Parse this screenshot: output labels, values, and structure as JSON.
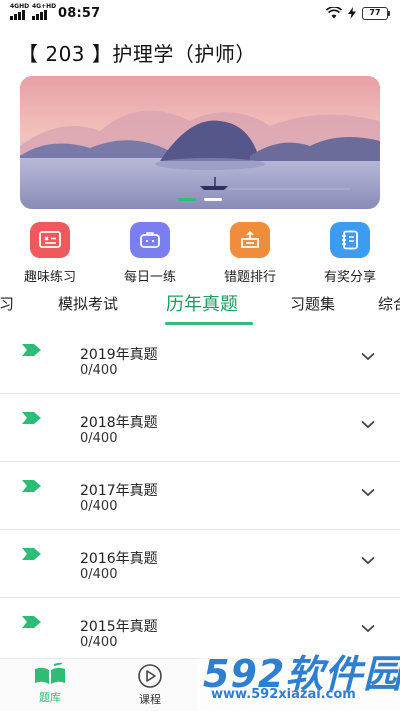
{
  "status_bar": {
    "signal1": "4GHD",
    "signal2": "4G+HD",
    "time": "08:57",
    "battery": "77",
    "icons": [
      "wifi-icon",
      "charging-icon",
      "battery-icon"
    ]
  },
  "page": {
    "title": "【 203 】护理学（护师）"
  },
  "banner": {
    "slide_count": 2,
    "active_slide": 1
  },
  "quick_menu": [
    {
      "label": "趣味练习",
      "icon": "quiz-board-icon",
      "color": "#f0595c"
    },
    {
      "label": "每日一练",
      "icon": "toolbox-icon",
      "color": "#7b7ef0"
    },
    {
      "label": "错题排行",
      "icon": "ranking-icon",
      "color": "#f08c3a"
    },
    {
      "label": "有奖分享",
      "icon": "notebook-icon",
      "color": "#3d9cf0"
    }
  ],
  "tabs": [
    {
      "label": "练习",
      "active": false
    },
    {
      "label": "模拟考试",
      "active": false
    },
    {
      "label": "历年真题",
      "active": true
    },
    {
      "label": "习题集",
      "active": false
    },
    {
      "label": "综合",
      "active": false
    }
  ],
  "exam_list": [
    {
      "title": "2019年真题",
      "progress": "0/400"
    },
    {
      "title": "2018年真题",
      "progress": "0/400"
    },
    {
      "title": "2017年真题",
      "progress": "0/400"
    },
    {
      "title": "2016年真题",
      "progress": "0/400"
    },
    {
      "title": "2015年真题",
      "progress": "0/400"
    }
  ],
  "bottom_nav": [
    {
      "label": "题库",
      "icon": "book-icon",
      "active": true
    },
    {
      "label": "课程",
      "icon": "play-icon",
      "active": false
    }
  ],
  "watermark": {
    "brand": "592软件园",
    "url": "www.592xiazai.com"
  },
  "colors": {
    "accent": "#2ebd77",
    "active_tab": "#1f9d5b",
    "watermark": "#2f7fd0"
  }
}
